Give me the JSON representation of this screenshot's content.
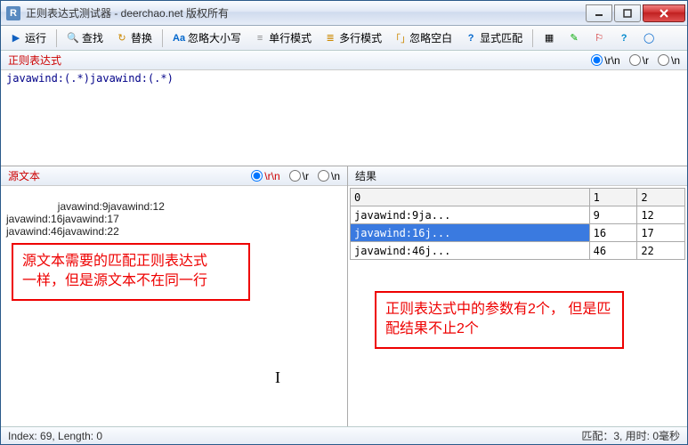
{
  "titlebar": {
    "icon": "R",
    "text": "正则表达式测试器 - deerchao.net 版权所有"
  },
  "toolbar": {
    "run": "运行",
    "find": "查找",
    "replace": "替换",
    "ignorecase": "忽略大小写",
    "singleline": "单行模式",
    "multiline": "多行模式",
    "ignorews": "忽略空白",
    "explicit": "显式匹配"
  },
  "labels": {
    "regex": "正则表达式",
    "source": "源文本",
    "result": "结果"
  },
  "radios": {
    "rn": "\\r\\n",
    "r": "\\r",
    "n": "\\n"
  },
  "regex_input": "javawind:(.*)javawind:(.*)",
  "source_input": "javawind:9javawind:12\njavawind:16javawind:17\njavawind:46javawind:22",
  "results": {
    "headers": [
      "0",
      "1",
      "2"
    ],
    "rows": [
      {
        "c0": "javawind:9ja...",
        "c1": "9",
        "c2": "12"
      },
      {
        "c0": "javawind:16j...",
        "c1": "16",
        "c2": "17"
      },
      {
        "c0": "javawind:46j...",
        "c1": "46",
        "c2": "22"
      }
    ],
    "selected": 1
  },
  "annotations": {
    "left": "源文本需要的匹配正则表达式\n一样，但是源文本不在同一行",
    "right": "正则表达式中的参数有2个，\n但是匹配结果不止2个"
  },
  "status": {
    "left": "Index: 69, Length: 0",
    "right": "匹配：3, 用时: 0毫秒"
  }
}
